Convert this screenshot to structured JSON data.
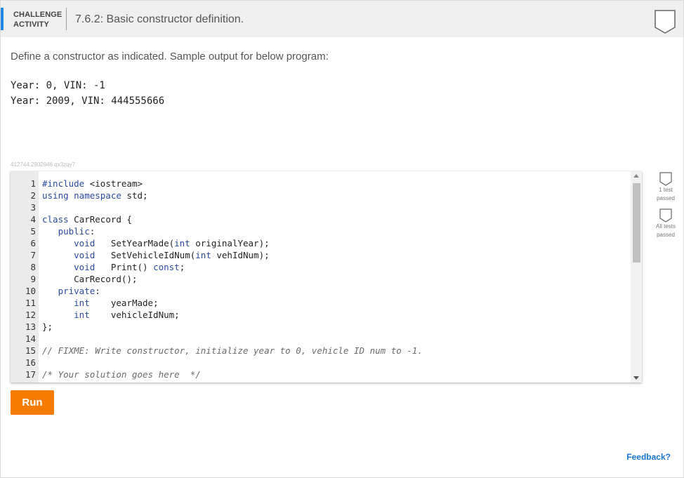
{
  "header": {
    "badge_line1": "CHALLENGE",
    "badge_line2": "ACTIVITY",
    "title": "7.6.2: Basic constructor definition.",
    "icon": "bookmark-shield-icon",
    "accent_color": "#1e88e5"
  },
  "description": "Define a constructor as indicated. Sample output for below program:",
  "sample_output": [
    "Year: 0, VIN: -1",
    "Year: 2009, VIN: 444555666"
  ],
  "editor": {
    "id_label": "412744.2902946.qx3zqy7",
    "line_numbers": [
      "1",
      "2",
      "3",
      "4",
      "5",
      "6",
      "7",
      "8",
      "9",
      "10",
      "11",
      "12",
      "13",
      "14",
      "15",
      "16",
      "17"
    ]
  },
  "tests": [
    {
      "label_line1": "1 test",
      "label_line2": "passed"
    },
    {
      "label_line1": "All tests",
      "label_line2": "passed"
    }
  ],
  "run_label": "Run",
  "run_color": "#f57c00",
  "feedback_label": "Feedback?"
}
